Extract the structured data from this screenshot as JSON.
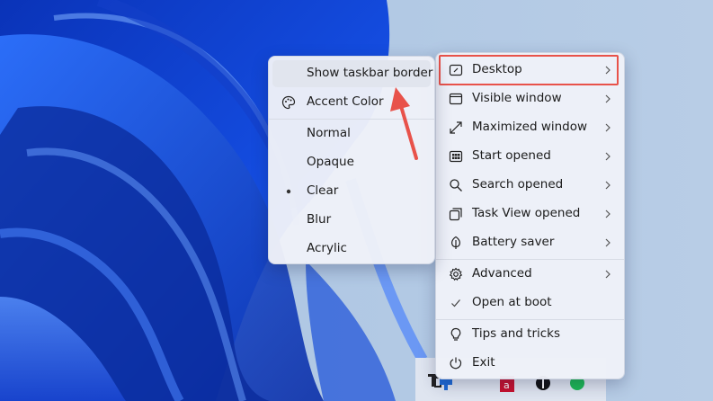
{
  "main_menu": {
    "items": [
      {
        "label": "Desktop",
        "icon": "desktop-icon",
        "has_submenu": true
      },
      {
        "label": "Visible window",
        "icon": "window-icon",
        "has_submenu": true
      },
      {
        "label": "Maximized window",
        "icon": "maximize-icon",
        "has_submenu": true
      },
      {
        "label": "Start opened",
        "icon": "start-grid-icon",
        "has_submenu": true
      },
      {
        "label": "Search opened",
        "icon": "search-icon",
        "has_submenu": true
      },
      {
        "label": "Task View opened",
        "icon": "task-view-icon",
        "has_submenu": true
      },
      {
        "label": "Battery saver",
        "icon": "leaf-icon",
        "has_submenu": true
      },
      {
        "label": "Advanced",
        "icon": "gear-icon",
        "has_submenu": true
      },
      {
        "label": "Open at boot",
        "icon": "checkmark-icon",
        "has_submenu": false
      },
      {
        "label": "Tips and tricks",
        "icon": "lightbulb-icon",
        "has_submenu": false
      },
      {
        "label": "Exit",
        "icon": "power-icon",
        "has_submenu": false
      }
    ]
  },
  "sub_menu": {
    "items": [
      {
        "label": "Show taskbar border"
      },
      {
        "label": "Accent Color",
        "icon": "palette-icon"
      },
      {
        "label": "Normal"
      },
      {
        "label": "Opaque"
      },
      {
        "label": "Clear",
        "selected": true
      },
      {
        "label": "Blur"
      },
      {
        "label": "Acrylic"
      }
    ]
  },
  "colors": {
    "highlight_outline": "#e8524a",
    "annotation_arrow": "#e8524a",
    "menu_background": "#eef1f8"
  }
}
